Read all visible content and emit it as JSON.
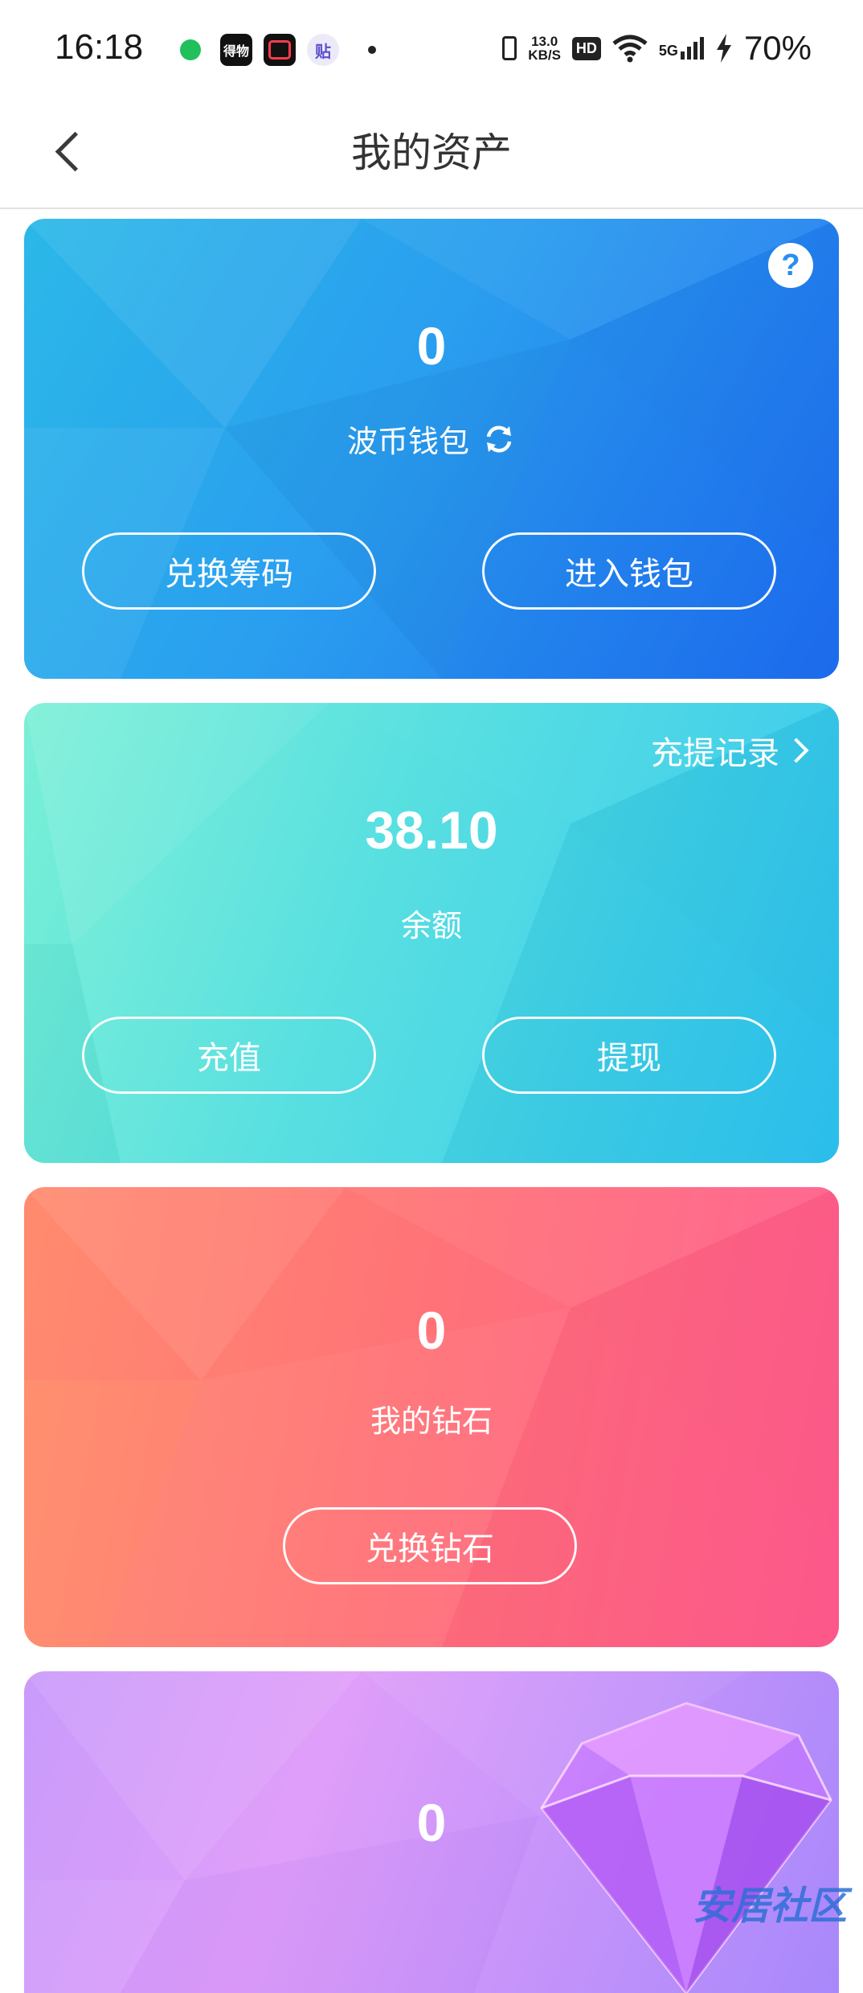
{
  "status_bar": {
    "time": "16:18",
    "speed_value": "13.0",
    "speed_unit": "KB/S",
    "hd": "HD",
    "network": "5G",
    "battery": "70%",
    "notification_icons": [
      "wechat-like-green-dot",
      "app-icon-black",
      "app-icon-red",
      "tieba-icon"
    ],
    "app_icon_text": "得物",
    "tieba_text": "贴"
  },
  "header": {
    "title": "我的资产"
  },
  "wallet_card": {
    "amount": "0",
    "label": "波币钱包",
    "exchange_button": "兑换筹码",
    "enter_button": "进入钱包",
    "help_symbol": "?",
    "gradient": [
      "#2bb8e8",
      "#1f6ff0"
    ]
  },
  "balance_card": {
    "amount": "38.10",
    "label": "余额",
    "records_link": "充提记录",
    "recharge_button": "充值",
    "withdraw_button": "提现",
    "gradient": [
      "#7af0d6",
      "#2ec4ef"
    ]
  },
  "diamond_card": {
    "amount": "0",
    "label": "我的钻石",
    "exchange_button": "兑换钻石",
    "gradient": [
      "#ff8b6e",
      "#ff5c8e"
    ]
  },
  "gem_card": {
    "amount": "0",
    "gradient": [
      "#c99bfb",
      "#a888fb"
    ]
  },
  "watermark": "安居社区"
}
